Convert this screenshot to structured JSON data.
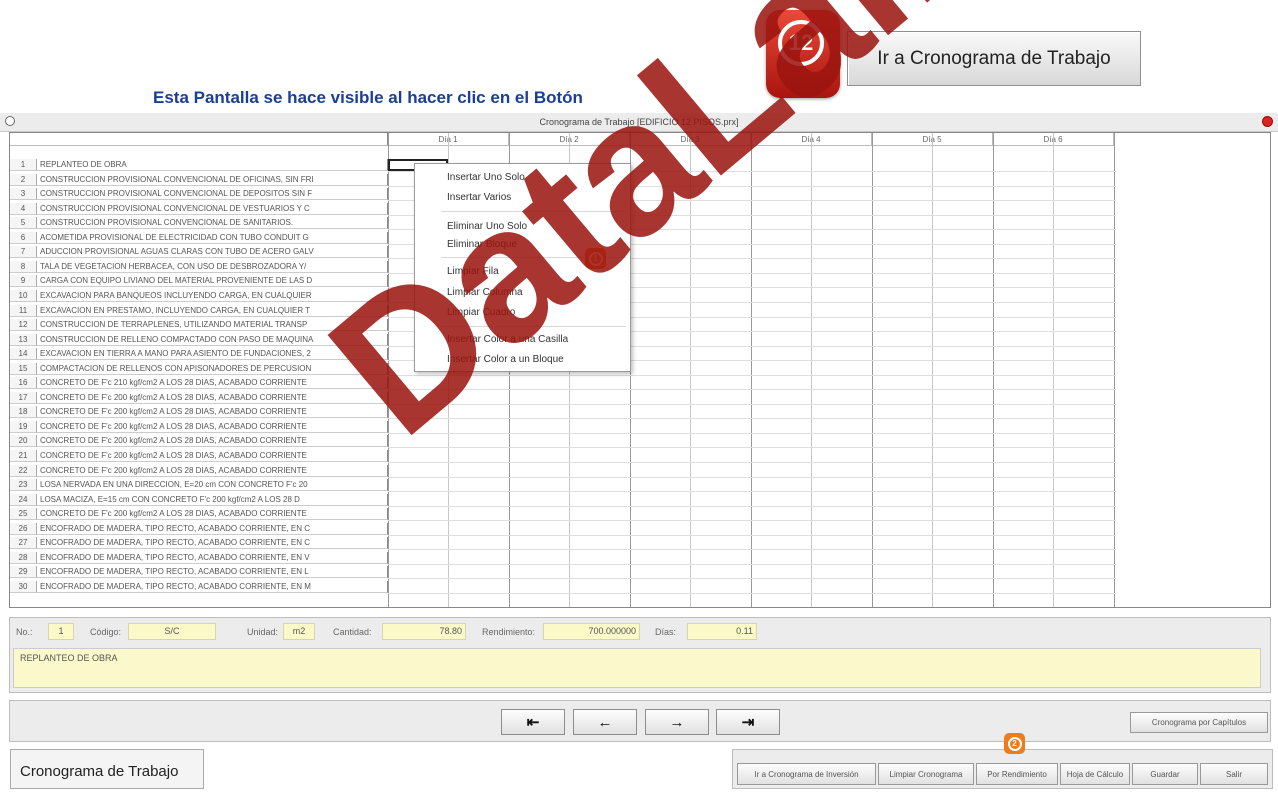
{
  "annotation": {
    "caption": "Esta Pantalla se hace visible al hacer clic en el Botón",
    "badge_number": "12",
    "goto_button_label": "Ir a Cronograma de Trabajo",
    "menu_badge": "1",
    "button_badge": "2"
  },
  "window": {
    "title": "Cronograma de Trabajo [EDIFICIO 12 PISOS.prx]"
  },
  "grid": {
    "days": [
      "Día 1",
      "Día 2",
      "Día 3",
      "Día 4",
      "Día 5",
      "Día 6"
    ],
    "rows": [
      {
        "num": "1",
        "desc": "REPLANTEO DE OBRA"
      },
      {
        "num": "2",
        "desc": "CONSTRUCCION PROVISIONAL CONVENCIONAL DE OFICINAS, SIN FRI"
      },
      {
        "num": "3",
        "desc": "CONSTRUCCION PROVISIONAL CONVENCIONAL DE DEPOSITOS SIN F"
      },
      {
        "num": "4",
        "desc": "CONSTRUCCION PROVISIONAL CONVENCIONAL DE VESTUARIOS Y C"
      },
      {
        "num": "5",
        "desc": "CONSTRUCCION PROVISIONAL CONVENCIONAL DE SANITARIOS."
      },
      {
        "num": "6",
        "desc": "ACOMETIDA PROVISIONAL DE ELECTRICIDAD CON TUBO CONDUIT G"
      },
      {
        "num": "7",
        "desc": "ADUCCION PROVISIONAL AGUAS CLARAS CON TUBO DE ACERO GALV"
      },
      {
        "num": "8",
        "desc": "TALA DE VEGETACION HERBACEA, CON USO DE DESBROZADORA Y/"
      },
      {
        "num": "9",
        "desc": "CARGA CON EQUIPO LIVIANO DEL MATERIAL PROVENIENTE DE LAS D"
      },
      {
        "num": "10",
        "desc": "EXCAVACION PARA BANQUEOS INCLUYENDO CARGA, EN CUALQUIER"
      },
      {
        "num": "11",
        "desc": "EXCAVACION EN PRESTAMO, INCLUYENDO CARGA, EN CUALQUIER T"
      },
      {
        "num": "12",
        "desc": "CONSTRUCCION DE TERRAPLENES, UTILIZANDO MATERIAL TRANSP"
      },
      {
        "num": "13",
        "desc": "CONSTRUCCION DE RELLENO COMPACTADO CON PASO DE MAQUINA"
      },
      {
        "num": "14",
        "desc": "EXCAVACION EN TIERRA A MANO PARA ASIENTO DE FUNDACIONES, 2"
      },
      {
        "num": "15",
        "desc": "COMPACTACION DE RELLENOS CON APISONADORES DE PERCUSION"
      },
      {
        "num": "16",
        "desc": "CONCRETO DE F'c 210 kgf/cm2 A LOS 28 DIAS, ACABADO CORRIENTE"
      },
      {
        "num": "17",
        "desc": "CONCRETO DE F'c 200 kgf/cm2 A LOS 28 DIAS, ACABADO CORRIENTE"
      },
      {
        "num": "18",
        "desc": "CONCRETO DE F'c 200 kgf/cm2 A LOS 28 DIAS, ACABADO CORRIENTE"
      },
      {
        "num": "19",
        "desc": "CONCRETO DE F'c 200 kgf/cm2 A LOS 28 DIAS, ACABADO CORRIENTE"
      },
      {
        "num": "20",
        "desc": "CONCRETO DE F'c 200 kgf/cm2 A LOS 28 DIAS, ACABADO CORRIENTE"
      },
      {
        "num": "21",
        "desc": "CONCRETO DE F'c 200 kgf/cm2 A LOS 28 DIAS, ACABADO CORRIENTE"
      },
      {
        "num": "22",
        "desc": "CONCRETO DE F'c 200 kgf/cm2 A LOS 28 DIAS, ACABADO CORRIENTE"
      },
      {
        "num": "23",
        "desc": "LOSA NERVADA EN UNA DIRECCION, E=20 cm CON CONCRETO F'c 20"
      },
      {
        "num": "24",
        "desc": "LOSA MACIZA, E=15 cm CON CONCRETO F'c 200 kgf/cm2 A LOS 28 D"
      },
      {
        "num": "25",
        "desc": "CONCRETO DE F'c 200 kgf/cm2 A LOS 28 DIAS, ACABADO CORRIENTE"
      },
      {
        "num": "26",
        "desc": "ENCOFRADO DE MADERA, TIPO RECTO, ACABADO CORRIENTE, EN C"
      },
      {
        "num": "27",
        "desc": "ENCOFRADO DE MADERA, TIPO RECTO, ACABADO CORRIENTE, EN C"
      },
      {
        "num": "28",
        "desc": "ENCOFRADO DE MADERA, TIPO RECTO, ACABADO CORRIENTE, EN V"
      },
      {
        "num": "29",
        "desc": "ENCOFRADO DE MADERA, TIPO RECTO, ACABADO CORRIENTE, EN L"
      },
      {
        "num": "30",
        "desc": "ENCOFRADO DE MADERA, TIPO RECTO, ACABADO CORRIENTE, EN M"
      }
    ]
  },
  "context_menu": {
    "items": [
      "Insertar Uno Solo",
      "Insertar Varios",
      "Eliminar Uno Solo",
      "Eliminar Bloque",
      "Limpiar Fila",
      "Limpiar Columna",
      "Limpiar Cuadro",
      "Insertar Color a una Casilla",
      "Insertar Color a un Bloque"
    ]
  },
  "info": {
    "no_label": "No.:",
    "no_value": "1",
    "codigo_label": "Código:",
    "codigo_value": "S/C",
    "unidad_label": "Unidad:",
    "unidad_value": "m2",
    "cantidad_label": "Cantidad:",
    "cantidad_value": "78.80",
    "rendimiento_label": "Rendimiento:",
    "rendimiento_value": "700.000000",
    "dias_label": "Días:",
    "dias_value": "0.11",
    "description": "REPLANTEO DE OBRA"
  },
  "nav": {
    "first": "⇤",
    "prev": "←",
    "next": "→",
    "last": "⇥",
    "chapters_button": "Cronograma por Capítulos"
  },
  "bottom": {
    "screen_label": "Cronograma de Trabajo",
    "buttons": [
      "Ir a Cronograma de Inversión",
      "Limpiar Cronograma",
      "Por Rendimiento",
      "Hoja de Cálculo",
      "Guardar",
      "Salir"
    ]
  },
  "watermark": "DataLaing",
  "colors": {
    "annotation_text": "#1a3f96",
    "badge_red": "#c9261b",
    "badge_orange": "#f07b1a",
    "field_yellow": "#fbf9c8"
  }
}
